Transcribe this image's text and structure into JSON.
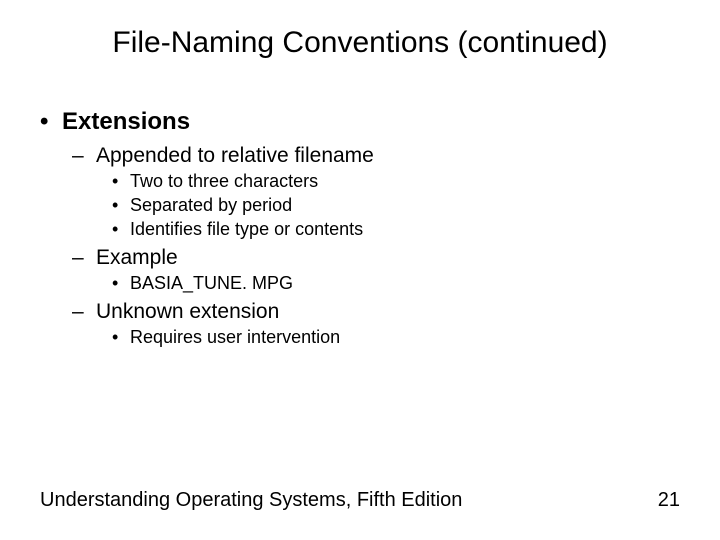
{
  "title": "File-Naming Conventions (continued)",
  "content": {
    "item0": "Extensions",
    "item0_0": "Appended to relative filename",
    "item0_0_0": "Two to three characters",
    "item0_0_1": "Separated by period",
    "item0_0_2": "Identifies file type or contents",
    "item0_1": "Example",
    "item0_1_0": "BASIA_TUNE. MPG",
    "item0_2": "Unknown extension",
    "item0_2_0": "Requires user intervention"
  },
  "footer": {
    "source": "Understanding Operating Systems, Fifth Edition",
    "page": "21"
  }
}
